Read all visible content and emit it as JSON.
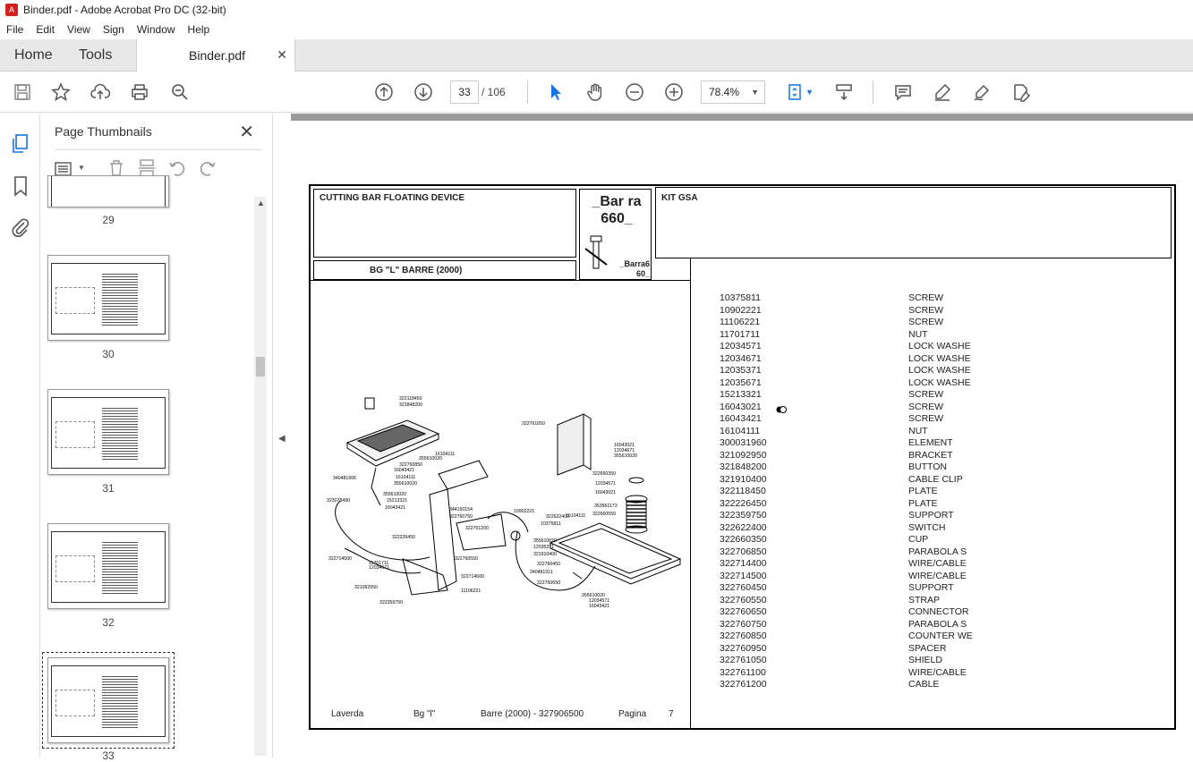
{
  "window": {
    "title": "Binder.pdf - Adobe Acrobat Pro DC (32-bit)"
  },
  "menu": [
    "File",
    "Edit",
    "View",
    "Sign",
    "Window",
    "Help"
  ],
  "tabs": {
    "home": "Home",
    "tools": "Tools",
    "document": "Binder.pdf"
  },
  "nav": {
    "current_page": "33",
    "total_pages": "/ 106",
    "zoom": "78.4%"
  },
  "thumbnails": {
    "title": "Page Thumbnails",
    "pages": [
      "29",
      "30",
      "31",
      "32",
      "33"
    ],
    "selected": "33"
  },
  "document": {
    "heading_left": "CUTTING BAR FLOATING DEVICE",
    "heading_sub": "BG \"L\" BARRE (2000)",
    "logo_text": "_Bar ra 660_",
    "logo_caption": "_Barra6 60_",
    "heading_right": "KIT GSA",
    "footer": {
      "brand": "Laverda",
      "model": "Bg \"l\"",
      "section": "Barre (2000) - 327906500",
      "page_label": "Pagina",
      "page_no": "7"
    },
    "parts": [
      {
        "code": "10375811",
        "desc": "SCREW"
      },
      {
        "code": "10902221",
        "desc": "SCREW"
      },
      {
        "code": "11106221",
        "desc": "SCREW"
      },
      {
        "code": "11701711",
        "desc": "NUT"
      },
      {
        "code": "12034571",
        "desc": "LOCK WASHE"
      },
      {
        "code": "12034671",
        "desc": "LOCK WASHE"
      },
      {
        "code": "12035371",
        "desc": "LOCK WASHE"
      },
      {
        "code": "12035671",
        "desc": "LOCK WASHE"
      },
      {
        "code": "15213321",
        "desc": "SCREW"
      },
      {
        "code": "16043021",
        "desc": "SCREW"
      },
      {
        "code": "16043421",
        "desc": "SCREW"
      },
      {
        "code": "16104111",
        "desc": "NUT"
      },
      {
        "code": "300031960",
        "desc": "ELEMENT"
      },
      {
        "code": "321092950",
        "desc": "BRACKET"
      },
      {
        "code": "321848200",
        "desc": "BUTTON"
      },
      {
        "code": "321910400",
        "desc": "CABLE CLIP"
      },
      {
        "code": "322118450",
        "desc": "PLATE"
      },
      {
        "code": "322226450",
        "desc": "PLATE"
      },
      {
        "code": "322359750",
        "desc": "SUPPORT"
      },
      {
        "code": "322622400",
        "desc": "SWITCH"
      },
      {
        "code": "322660350",
        "desc": "CUP"
      },
      {
        "code": "322706850",
        "desc": "PARABOLA S"
      },
      {
        "code": "322714400",
        "desc": "WIRE/CABLE"
      },
      {
        "code": "322714500",
        "desc": "WIRE/CABLE"
      },
      {
        "code": "322760450",
        "desc": "SUPPORT"
      },
      {
        "code": "322760550",
        "desc": "STRAP"
      },
      {
        "code": "322760650",
        "desc": "CONNECTOR"
      },
      {
        "code": "322760750",
        "desc": "PARABOLA S"
      },
      {
        "code": "322760850",
        "desc": "COUNTER WE"
      },
      {
        "code": "322760950",
        "desc": "SPACER"
      },
      {
        "code": "322761050",
        "desc": "SHIELD"
      },
      {
        "code": "322761100",
        "desc": "WIRE/CABLE"
      },
      {
        "code": "322761200",
        "desc": "CABLE"
      }
    ],
    "diagram_labels": [
      "322118450",
      "321848200",
      "322761050",
      "16043021",
      "12034671",
      "355610020",
      "16104111",
      "355610020",
      "322760850",
      "16043421",
      "322660350",
      "340481906",
      "16104111",
      "355610020",
      "12034571",
      "16043021",
      "323078490",
      "355610020",
      "15213321",
      "16043421",
      "344150154",
      "322760750",
      "322761200",
      "322226450",
      "322714500",
      "11701711",
      "12034671",
      "321092950",
      "322359750",
      "11106221",
      "322714600",
      "322760550",
      "322760450",
      "340481911",
      "322760650",
      "355610020",
      "12034571",
      "16043421",
      "10375811",
      "322622400",
      "355610020",
      "321910400",
      "353561173",
      "322660550",
      "16104111",
      "10902221",
      "12035371"
    ]
  }
}
